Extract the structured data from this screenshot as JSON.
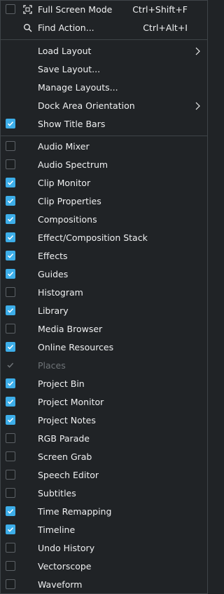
{
  "top": [
    {
      "label": "Full Screen Mode",
      "shortcut": "Ctrl+Shift+F",
      "icon": "fullscreen-icon",
      "checkbox": "off"
    },
    {
      "label": "Find Action...",
      "shortcut": "Ctrl+Alt+I",
      "icon": "search-icon"
    }
  ],
  "layout": [
    {
      "label": "Load Layout",
      "submenu": true
    },
    {
      "label": "Save Layout..."
    },
    {
      "label": "Manage Layouts..."
    },
    {
      "label": "Dock Area Orientation",
      "submenu": true
    },
    {
      "label": "Show Title Bars",
      "checked": true
    }
  ],
  "docks": [
    {
      "label": "Audio Mixer",
      "checked": false
    },
    {
      "label": "Audio Spectrum",
      "checked": false
    },
    {
      "label": "Clip Monitor",
      "checked": true
    },
    {
      "label": "Clip Properties",
      "checked": true
    },
    {
      "label": "Compositions",
      "checked": true
    },
    {
      "label": "Effect/Composition Stack",
      "checked": true
    },
    {
      "label": "Effects",
      "checked": true
    },
    {
      "label": "Guides",
      "checked": true
    },
    {
      "label": "Histogram",
      "checked": false
    },
    {
      "label": "Library",
      "checked": true
    },
    {
      "label": "Media Browser",
      "checked": false
    },
    {
      "label": "Online Resources",
      "checked": true
    },
    {
      "label": "Places",
      "checked": true,
      "disabled": true
    },
    {
      "label": "Project Bin",
      "checked": true
    },
    {
      "label": "Project Monitor",
      "checked": true
    },
    {
      "label": "Project Notes",
      "checked": true
    },
    {
      "label": "RGB Parade",
      "checked": false
    },
    {
      "label": "Screen Grab",
      "checked": false
    },
    {
      "label": "Speech Editor",
      "checked": false
    },
    {
      "label": "Subtitles",
      "checked": false
    },
    {
      "label": "Time Remapping",
      "checked": true
    },
    {
      "label": "Timeline",
      "checked": true
    },
    {
      "label": "Undo History",
      "checked": false
    },
    {
      "label": "Vectorscope",
      "checked": false
    },
    {
      "label": "Waveform",
      "checked": false
    }
  ],
  "colors": {
    "accent": "#3daee9",
    "background": "#202326",
    "text": "#eff0f1",
    "disabled": "#6e7377"
  }
}
